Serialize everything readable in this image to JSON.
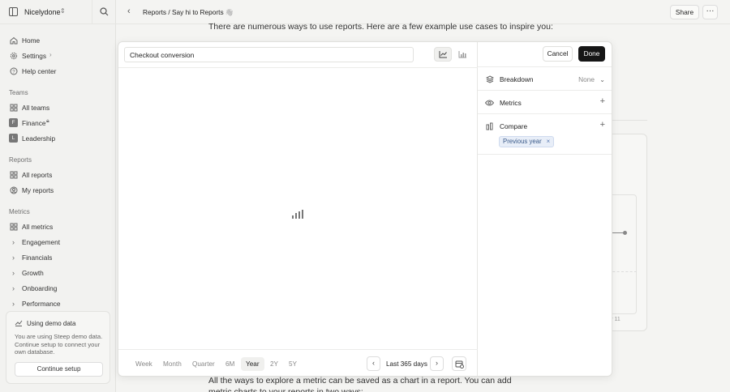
{
  "workspace": {
    "name": "Nicelydone"
  },
  "sidebar": {
    "top": [
      {
        "label": "Home",
        "icon": "home-icon"
      },
      {
        "label": "Settings",
        "icon": "gear-icon"
      },
      {
        "label": "Help center",
        "icon": "help-icon"
      }
    ],
    "teams_title": "Teams",
    "teams": [
      {
        "label": "All teams"
      },
      {
        "label": "Finance",
        "badge": "F"
      },
      {
        "label": "Leadership",
        "badge": "L"
      }
    ],
    "reports_title": "Reports",
    "reports": [
      {
        "label": "All reports"
      },
      {
        "label": "My reports"
      }
    ],
    "metrics_title": "Metrics",
    "metrics": [
      {
        "label": "All metrics"
      },
      {
        "label": "Engagement"
      },
      {
        "label": "Financials"
      },
      {
        "label": "Growth"
      },
      {
        "label": "Onboarding"
      },
      {
        "label": "Performance"
      }
    ],
    "demo": {
      "title": "Using demo data",
      "description": "You are using Steep demo data. Continue setup to connect your own database.",
      "button": "Continue setup"
    }
  },
  "topbar": {
    "breadcrumb": "Reports / Say hi to Reports",
    "emoji": "👋",
    "share": "Share",
    "more": "···"
  },
  "document": {
    "top_text": "There are numerous ways to use reports. Here are a few example use cases to inspire you:",
    "bottom_text": "All the ways to explore a metric can be saved as a chart in a report. You can add metric charts to your reports in two ways:",
    "axis_label": "v 11"
  },
  "modal": {
    "title": "Checkout conversion",
    "cancel": "Cancel",
    "done": "Done",
    "breakdown": {
      "label": "Breakdown",
      "value": "None"
    },
    "metrics": {
      "label": "Metrics",
      "action": "+"
    },
    "compare": {
      "label": "Compare",
      "action": "+",
      "chip": "Previous year",
      "chip_remove": "×"
    },
    "granularity": [
      "Week",
      "Month",
      "Quarter"
    ],
    "ranges": [
      "6M",
      "Year",
      "2Y",
      "5Y"
    ],
    "selected_range": "Year",
    "period": "Last 365 days",
    "prev": "‹",
    "next": "›"
  }
}
